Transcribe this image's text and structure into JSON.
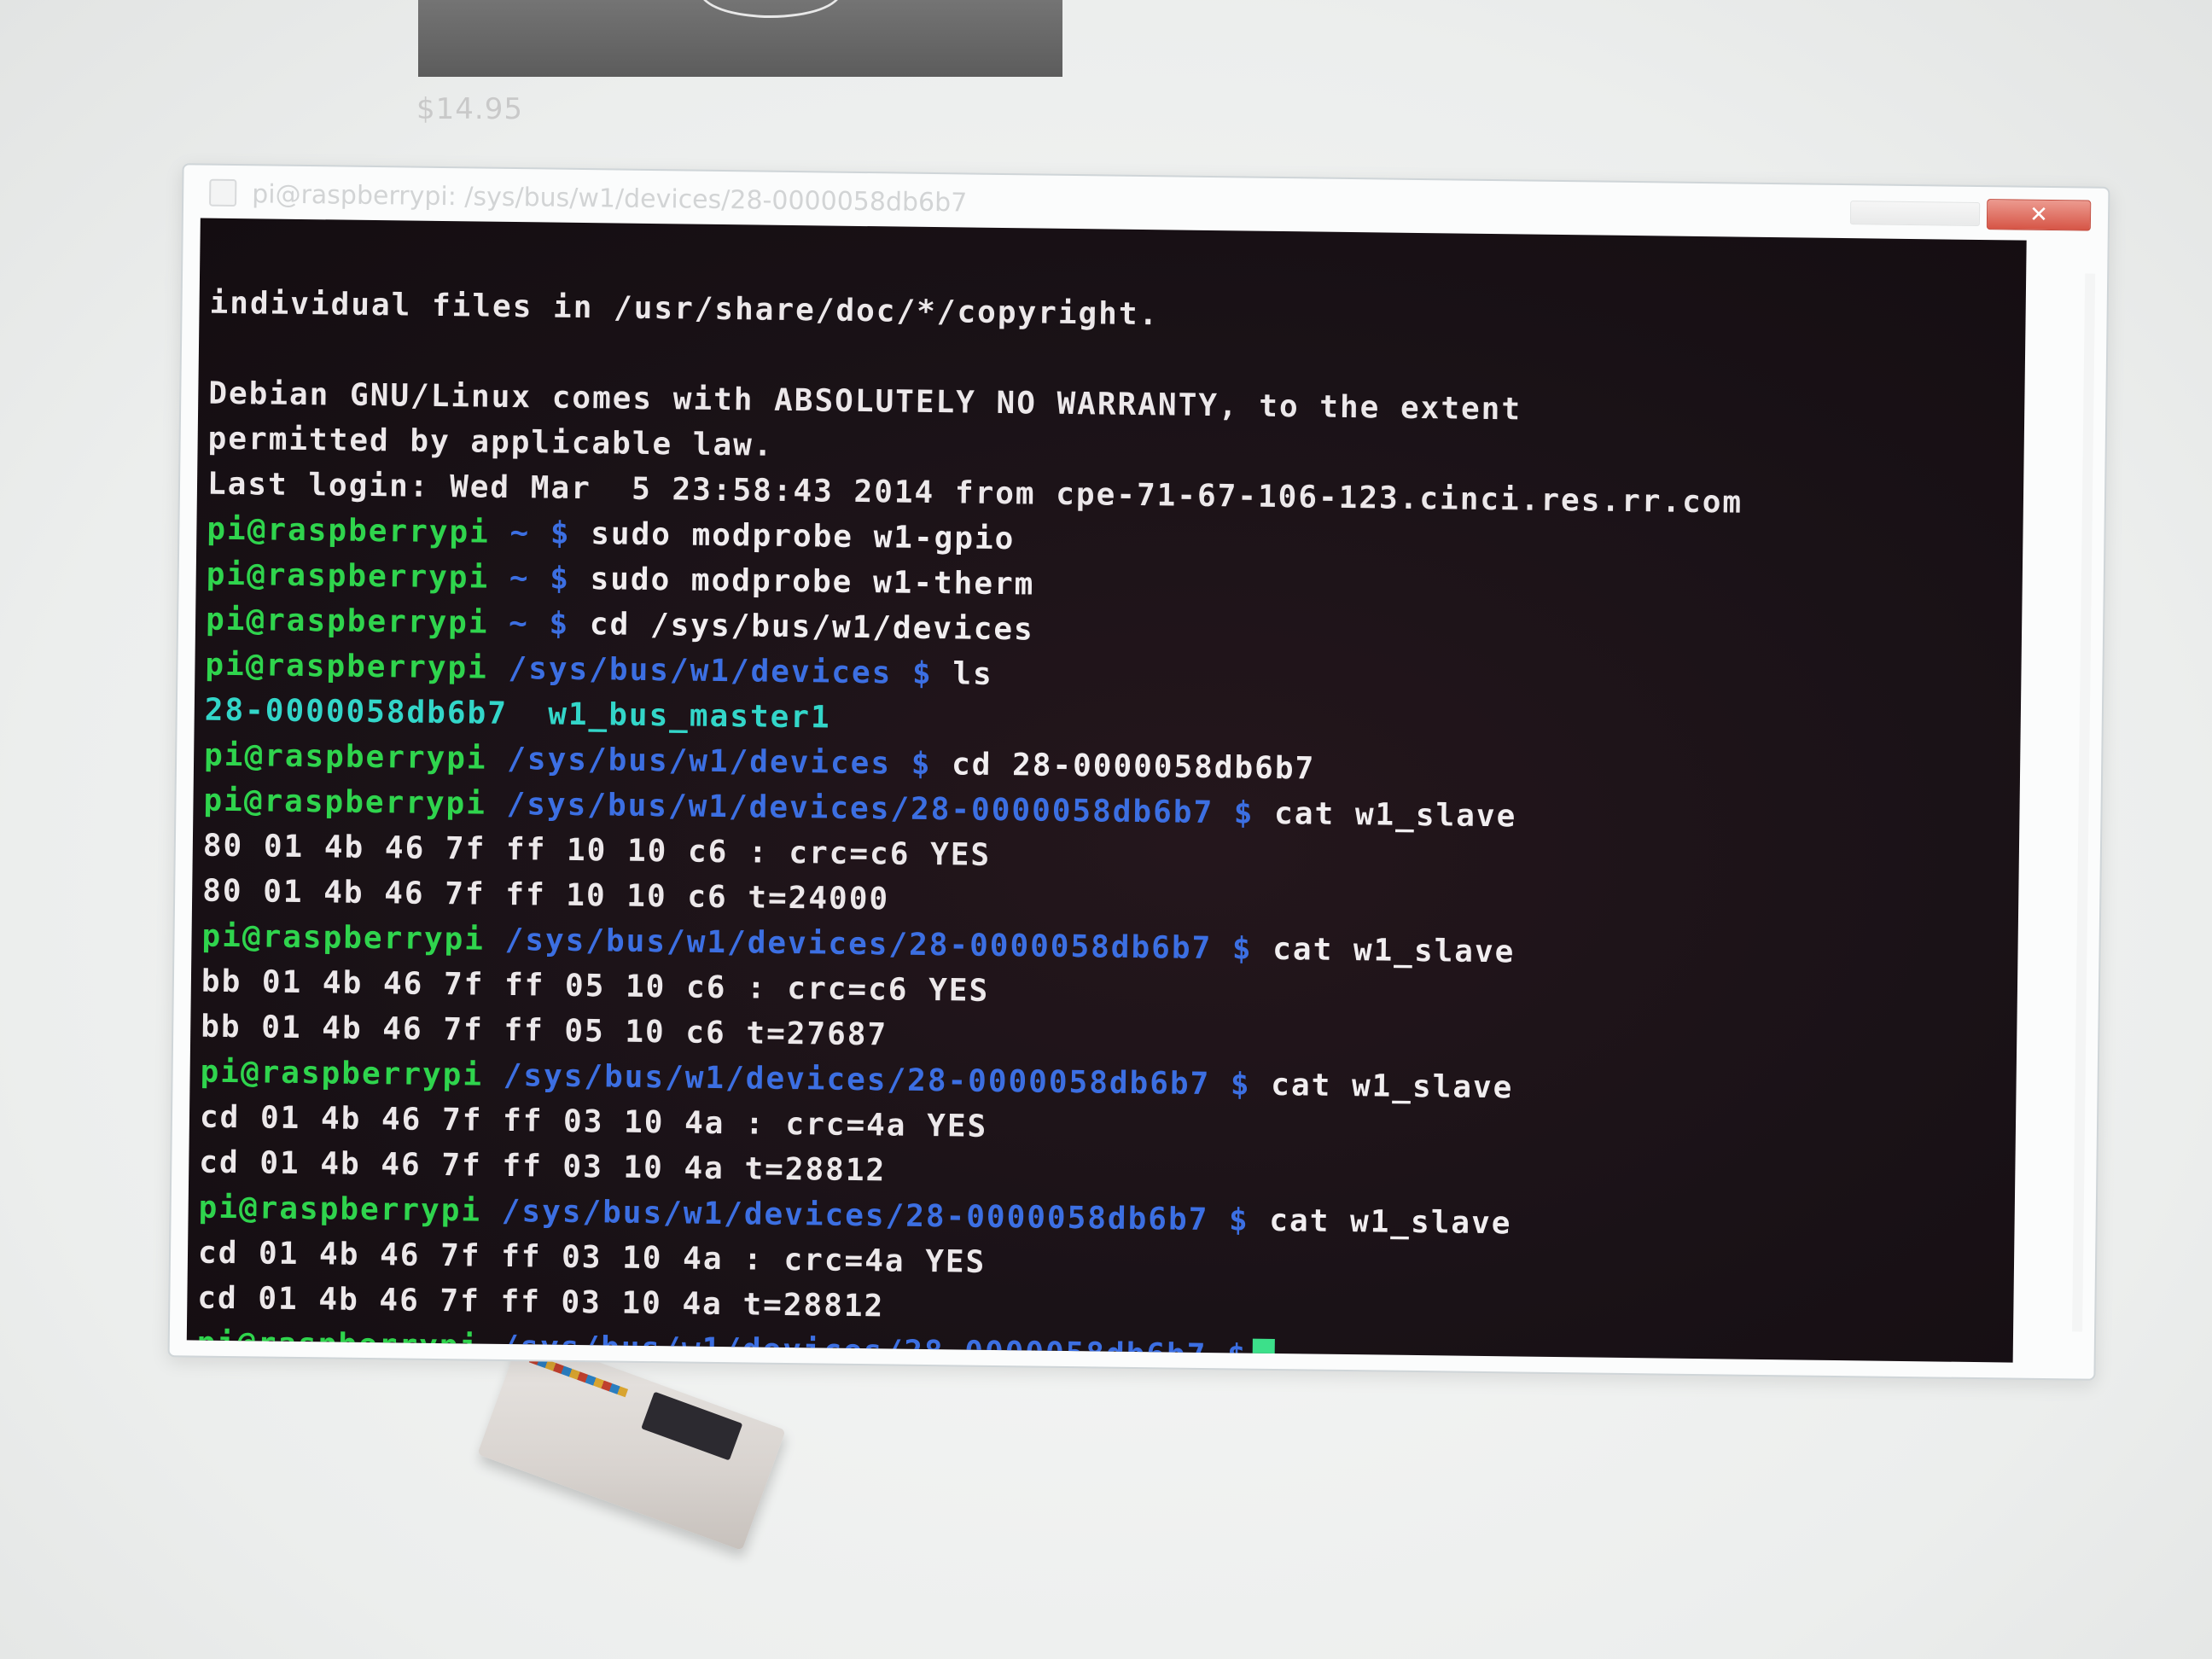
{
  "backdrop": {
    "price": "$14.95"
  },
  "window": {
    "title": "pi@raspberrypi: /sys/bus/w1/devices/28-0000058db6b7",
    "close_glyph": "✕"
  },
  "terminal": {
    "banner": [
      "individual files in /usr/share/doc/*/copyright.",
      "",
      "Debian GNU/Linux comes with ABSOLUTELY NO WARRANTY, to the extent",
      "permitted by applicable law.",
      "Last login: Wed Mar  5 23:58:43 2014 from cpe-71-67-106-123.cinci.res.rr.com"
    ],
    "prompt_user": "pi@raspberrypi",
    "home_dir": "~",
    "devices_dir": "/sys/bus/w1/devices",
    "sensor_dir": "/sys/bus/w1/devices/28-0000058db6b7",
    "dollar": "$",
    "commands": {
      "modprobe_gpio": "sudo modprobe w1-gpio",
      "modprobe_therm": "sudo modprobe w1-therm",
      "cd_devices": "cd /sys/bus/w1/devices",
      "ls": "ls",
      "cd_sensor": "cd 28-0000058db6b7",
      "cat_1": "cat w1_slave",
      "cat_2": "cat w1_slave",
      "cat_3": "cat w1_slave",
      "cat_4": "cat w1_slave"
    },
    "ls_output": {
      "sensor_entry": "28-0000058db6b7",
      "bus_entry": "w1_bus_master1"
    },
    "readings": {
      "r1_crc": "80 01 4b 46 7f ff 10 10 c6 : crc=c6 YES",
      "r1_temp": "80 01 4b 46 7f ff 10 10 c6 t=24000",
      "r2_crc": "bb 01 4b 46 7f ff 05 10 c6 : crc=c6 YES",
      "r2_temp": "bb 01 4b 46 7f ff 05 10 c6 t=27687",
      "r3_crc": "cd 01 4b 46 7f ff 03 10 4a : crc=4a YES",
      "r3_temp": "cd 01 4b 46 7f ff 03 10 4a t=28812",
      "r4_crc": "cd 01 4b 46 7f ff 03 10 4a : crc=4a YES",
      "r4_temp": "cd 01 4b 46 7f ff 03 10 4a t=28812"
    }
  }
}
